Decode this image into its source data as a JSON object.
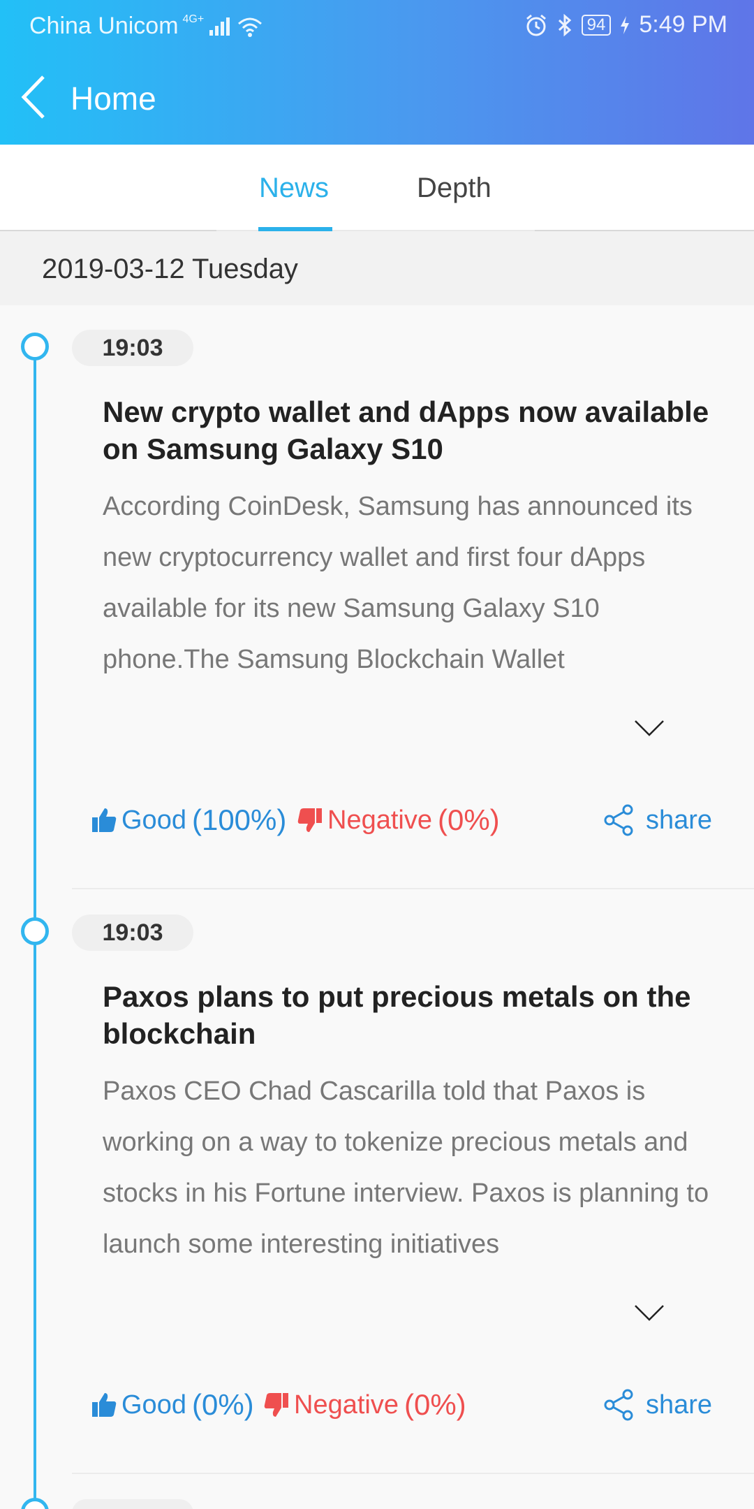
{
  "status_bar": {
    "carrier": "China Unicom",
    "network": "4G+",
    "battery": "94",
    "time": "5:49 PM"
  },
  "nav": {
    "title": "Home"
  },
  "tabs": [
    {
      "label": "News",
      "active": true
    },
    {
      "label": "Depth",
      "active": false
    }
  ],
  "date_header": "2019-03-12 Tuesday",
  "articles": [
    {
      "time": "19:03",
      "title": "New crypto wallet and dApps now available on Samsung Galaxy S10",
      "body": "According CoinDesk, Samsung has announced its new cryptocurrency wallet and first four dApps available for its new Samsung Galaxy S10 phone.The Samsung Blockchain Wallet",
      "good_label": "Good",
      "good_pct": "(100%)",
      "negative_label": "Negative",
      "negative_pct": "(0%)",
      "share_label": "share"
    },
    {
      "time": "19:03",
      "title": "Paxos plans to put precious metals on the blockchain",
      "body": "Paxos CEO Chad Cascarilla told that Paxos is working on a way to tokenize precious metals and stocks in his Fortune interview. Paxos is planning to launch some interesting initiatives",
      "good_label": "Good",
      "good_pct": "(0%)",
      "negative_label": "Negative",
      "negative_pct": "(0%)",
      "share_label": "share"
    }
  ],
  "colors": {
    "accent": "#2bb1ea",
    "timeline": "#32b6ef",
    "good": "#2a8cd8",
    "negative": "#ef4f4f"
  }
}
